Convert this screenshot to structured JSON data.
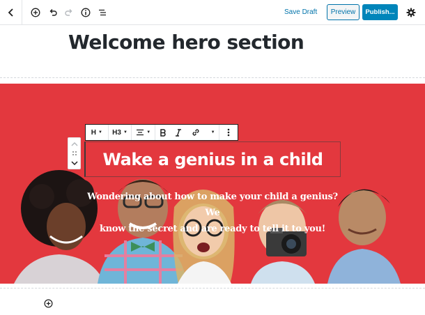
{
  "toolbar": {
    "save_draft_label": "Save Draft",
    "preview_label": "Preview",
    "publish_label": "Publish..."
  },
  "page_title": "Welcome hero section",
  "block_toolbar": {
    "block_type_label": "H",
    "heading_level_label": "H3"
  },
  "hero": {
    "background_color": "#e3383e",
    "heading": "Wake a genius in a child",
    "text_line1": "Wondering about how to make your child a genius? We",
    "text_line2": "know the secret and are ready to tell it to you!"
  },
  "icons": {
    "back": "chevron-left-icon",
    "add": "plus-circle-icon",
    "undo": "undo-icon",
    "redo": "redo-icon",
    "info": "info-icon",
    "outline": "list-icon",
    "settings": "gear-icon",
    "align": "align-center-icon",
    "bold": "bold-icon",
    "italic": "italic-icon",
    "link": "link-icon",
    "more": "more-vertical-icon",
    "move_up": "chevron-up-icon",
    "drag": "drag-handle-icon",
    "move_down": "chevron-down-icon"
  }
}
